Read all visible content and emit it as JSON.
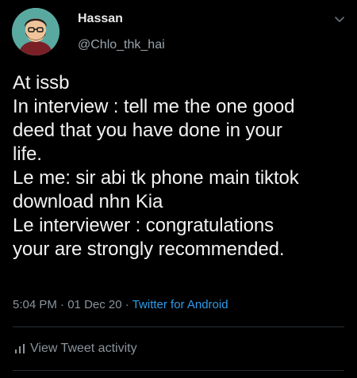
{
  "user": {
    "display_name": "Hassan",
    "username": "@Chlo_thk_hai"
  },
  "tweet": {
    "text": "At issb\nIn interview : tell me the one good\ndeed that you have done in your\nlife.\nLe me: sir abi tk phone main tiktok\ndownload nhn Kia\n Le interviewer : congratulations\nyour are strongly recommended.",
    "time": "5:04 PM",
    "separator": "·",
    "date": "01 Dec 20",
    "source": "Twitter for Android"
  },
  "actions": {
    "view_activity_label": "View Tweet activity"
  },
  "icons": {
    "menu": "chevron-down-icon",
    "activity": "bar-chart-icon"
  },
  "colors": {
    "background": "#000000",
    "link": "#2f9be8",
    "muted": "#8a949c"
  }
}
